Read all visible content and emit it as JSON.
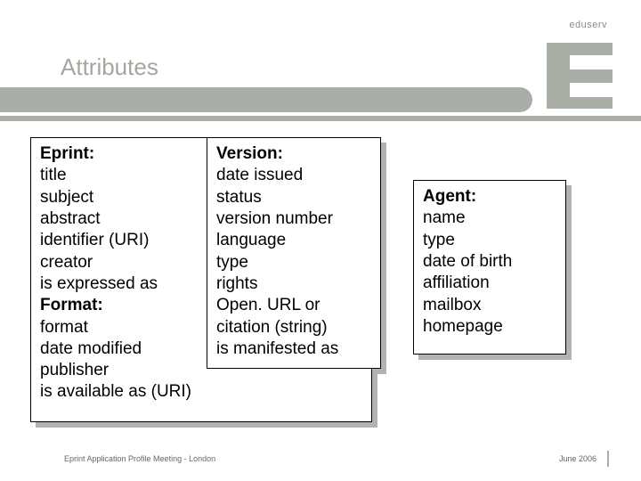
{
  "brand": "eduserv",
  "title": "Attributes",
  "boxes": {
    "eprint": {
      "heading1": "Eprint:",
      "l1": "title",
      "l2": "subject",
      "l3": "abstract",
      "l4": "identifier (URI)",
      "l5": "creator",
      "l6": "is expressed as",
      "heading2": "Format:",
      "l7": "format",
      "l8": "date modified",
      "l9": "publisher",
      "l10": "is available as (URI)"
    },
    "version": {
      "heading": "Version:",
      "l1": "date issued",
      "l2": "status",
      "l3": "version number",
      "l4": "language",
      "l5": "type",
      "l6": "rights",
      "l7": "Open. URL or",
      "l8": "citation (string)",
      "l9": "is manifested as"
    },
    "agent": {
      "heading": "Agent:",
      "l1": "name",
      "l2": "type",
      "l3": "date of birth",
      "l4": "affiliation",
      "l5": "mailbox",
      "l6": "homepage"
    }
  },
  "footer": {
    "left": "Eprint Application Profile Meeting - London",
    "right": "June 2006"
  }
}
